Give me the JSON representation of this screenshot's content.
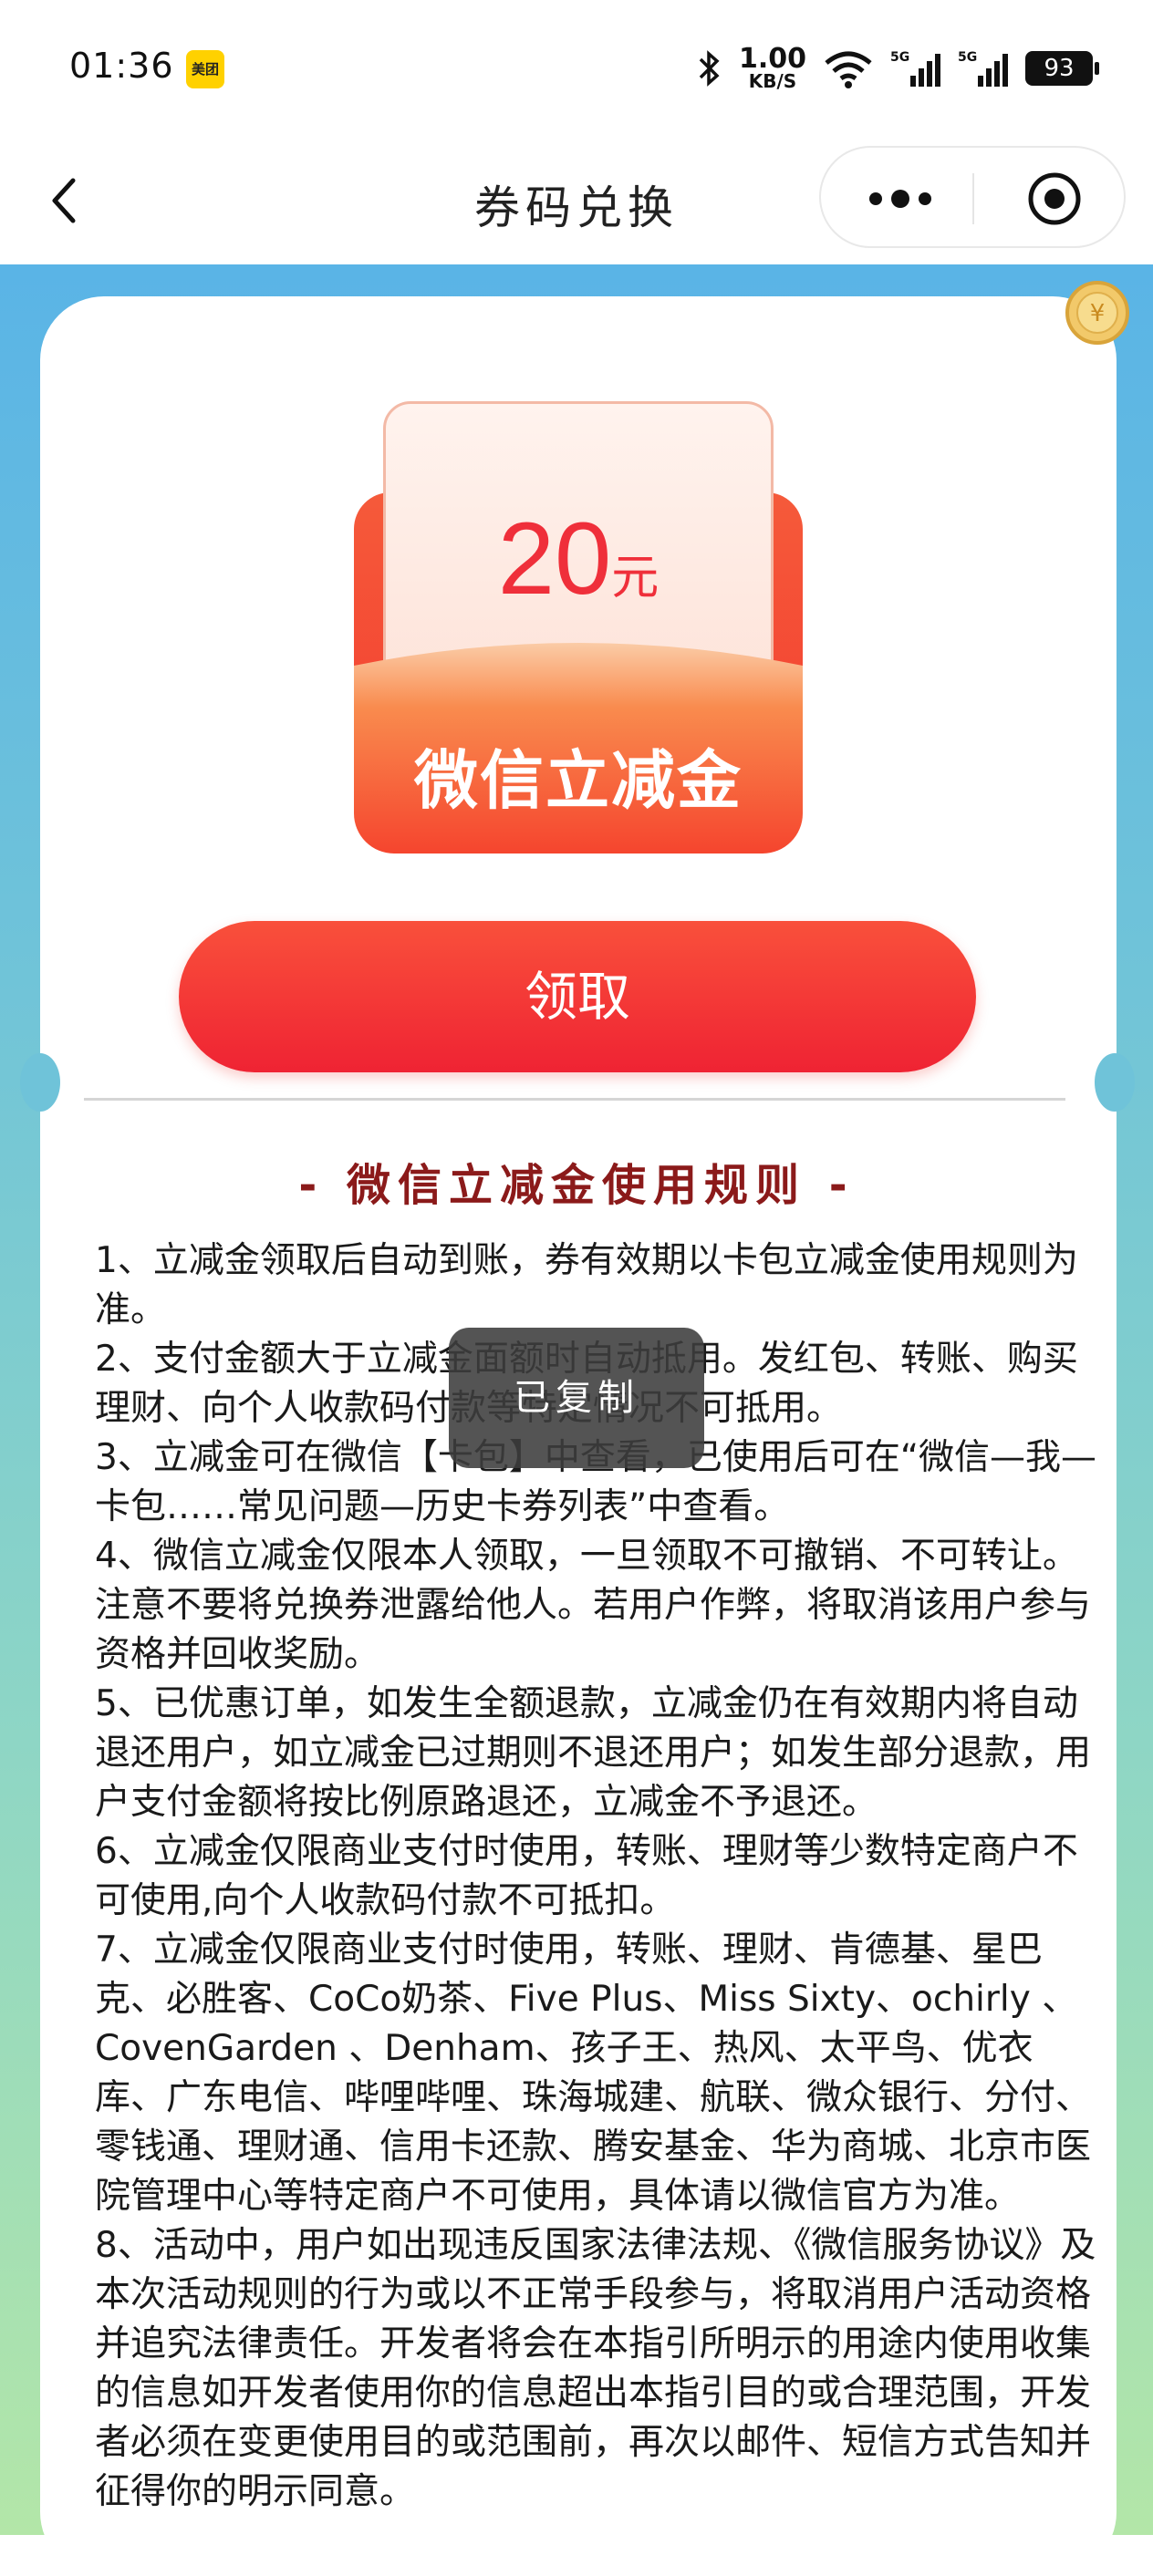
{
  "status_bar": {
    "time": "01:36",
    "app_badge": "美团",
    "speed_value": "1.00",
    "speed_unit": "KB/S",
    "battery": "93"
  },
  "nav": {
    "title": "券码兑换"
  },
  "coupon": {
    "amount": "20",
    "unit": "元",
    "label": "微信立减金"
  },
  "claim_button": "领取",
  "rules_title": "- 微信立减金使用规则 -",
  "rules": [
    "1、立减金领取后自动到账，券有效期以卡包立减金使用规则为准。",
    "2、支付金额大于立减金面额时自动抵用。发红包、转账、购买理财、向个人收款码付款等特定情况不可抵用。",
    "3、立减金可在微信【卡包】中查看，已使用后可在“微信—我—卡包……常见问题—历史卡券列表”中查看。",
    "4、微信立减金仅限本人领取，一旦领取不可撤销、不可转让。注意不要将兑换券泄露给他人。若用户作弊，将取消该用户参与资格并回收奖励。",
    "5、已优惠订单，如发生全额退款，立减金仍在有效期内将自动退还用户，如立减金已过期则不退还用户；如发生部分退款，用户支付金额将按比例原路退还，立减金不予退还。",
    "6、立减金仅限商业支付时使用，转账、理财等少数特定商户不可使用,向个人收款码付款不可抵扣。",
    "7、立减金仅限商业支付时使用，转账、理财、肯德基、星巴克、必胜客、CoCo奶茶、Five Plus、Miss Sixty、ochirly 、CovenGarden 、Denham、孩子王、热风、太平鸟、优衣库、广东电信、哔哩哔哩、珠海城建、航联、微众银行、分付、零钱通、理财通、信用卡还款、腾安基金、华为商城、北京市医院管理中心等特定商户不可使用，具体请以微信官方为准。",
    "8、活动中，用户如出现违反国家法律法规、《微信服务协议》及本次活动规则的行为或以不正常手段参与，将取消用户活动资格并追究法律责任。开发者将会在本指引所明示的用途内使用收集的信息如开发者使用你的信息超出本指引目的或合理范围，开发者必须在变更使用目的或范围前，再次以邮件、短信方式告知并征得你的明示同意。"
  ],
  "toast": "已复制",
  "colors": {
    "accent_red": "#ef2f3a",
    "rules_title": "#8b1a1a",
    "bg_top": "#5ab4e6",
    "bg_bottom": "#b3e6a8"
  },
  "icons": [
    "back-icon",
    "more-icon",
    "target-icon",
    "coin-icon",
    "bluetooth-icon",
    "wifi-icon",
    "signal-icon",
    "battery-icon"
  ]
}
